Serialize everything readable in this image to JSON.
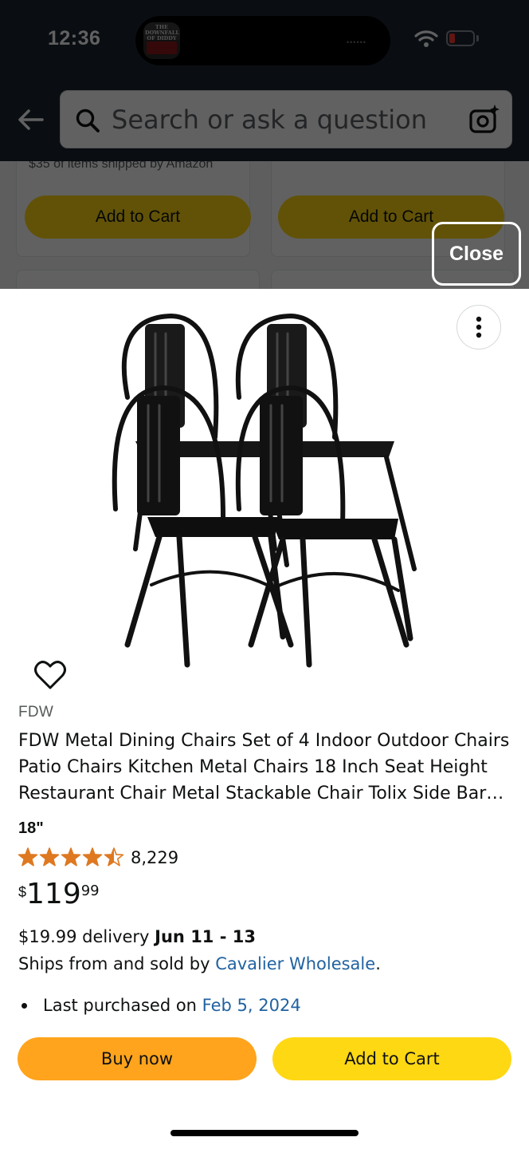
{
  "status_bar": {
    "time": "12:36",
    "now_playing_art_text": "THE DOWNFALL OF DIDDY",
    "indicator_dots": "••••••"
  },
  "search": {
    "placeholder": "Search or ask a question",
    "value": ""
  },
  "background_results": {
    "shipping_text": "$35 of items shipped by Amazon",
    "left_button_label": "Add to Cart",
    "right_button_label": "Add to Cart"
  },
  "overlay": {
    "close_label": "Close"
  },
  "product": {
    "brand": "FDW",
    "title": "FDW Metal Dining Chairs Set of 4 Indoor Outdoor Chairs Patio Chairs Kitchen Metal Chairs 18 Inch Seat Height Restaurant Chair Metal Stackable Chair Tolix Side Bar Chairs",
    "size": "18\"",
    "rating": 4.5,
    "rating_count": "8,229",
    "price": {
      "symbol": "$",
      "whole": "119",
      "fraction": "99"
    },
    "delivery": {
      "prefix": "$19.99 delivery ",
      "dates": "Jun 11 - 13"
    },
    "ships": {
      "prefix": "Ships from and sold by ",
      "seller": "Cavalier Wholesale",
      "suffix": "."
    },
    "purchase_history": {
      "prefix": "Last purchased on ",
      "date": "Feb 5, 2024"
    },
    "buy_now_label": "Buy now",
    "add_to_cart_label": "Add to Cart"
  },
  "icons": {
    "back": "back-arrow-icon",
    "search": "search-icon",
    "camera": "camera-lens-icon",
    "more": "more-options-icon",
    "heart": "heart-icon",
    "star": "star-icon"
  },
  "colors": {
    "header_bg": "#1c2531",
    "buy_now": "#ffa41c",
    "add_to_cart": "#ffd814",
    "link": "#2162a1",
    "star": "#de7921",
    "battery_low": "#ff3b30"
  }
}
